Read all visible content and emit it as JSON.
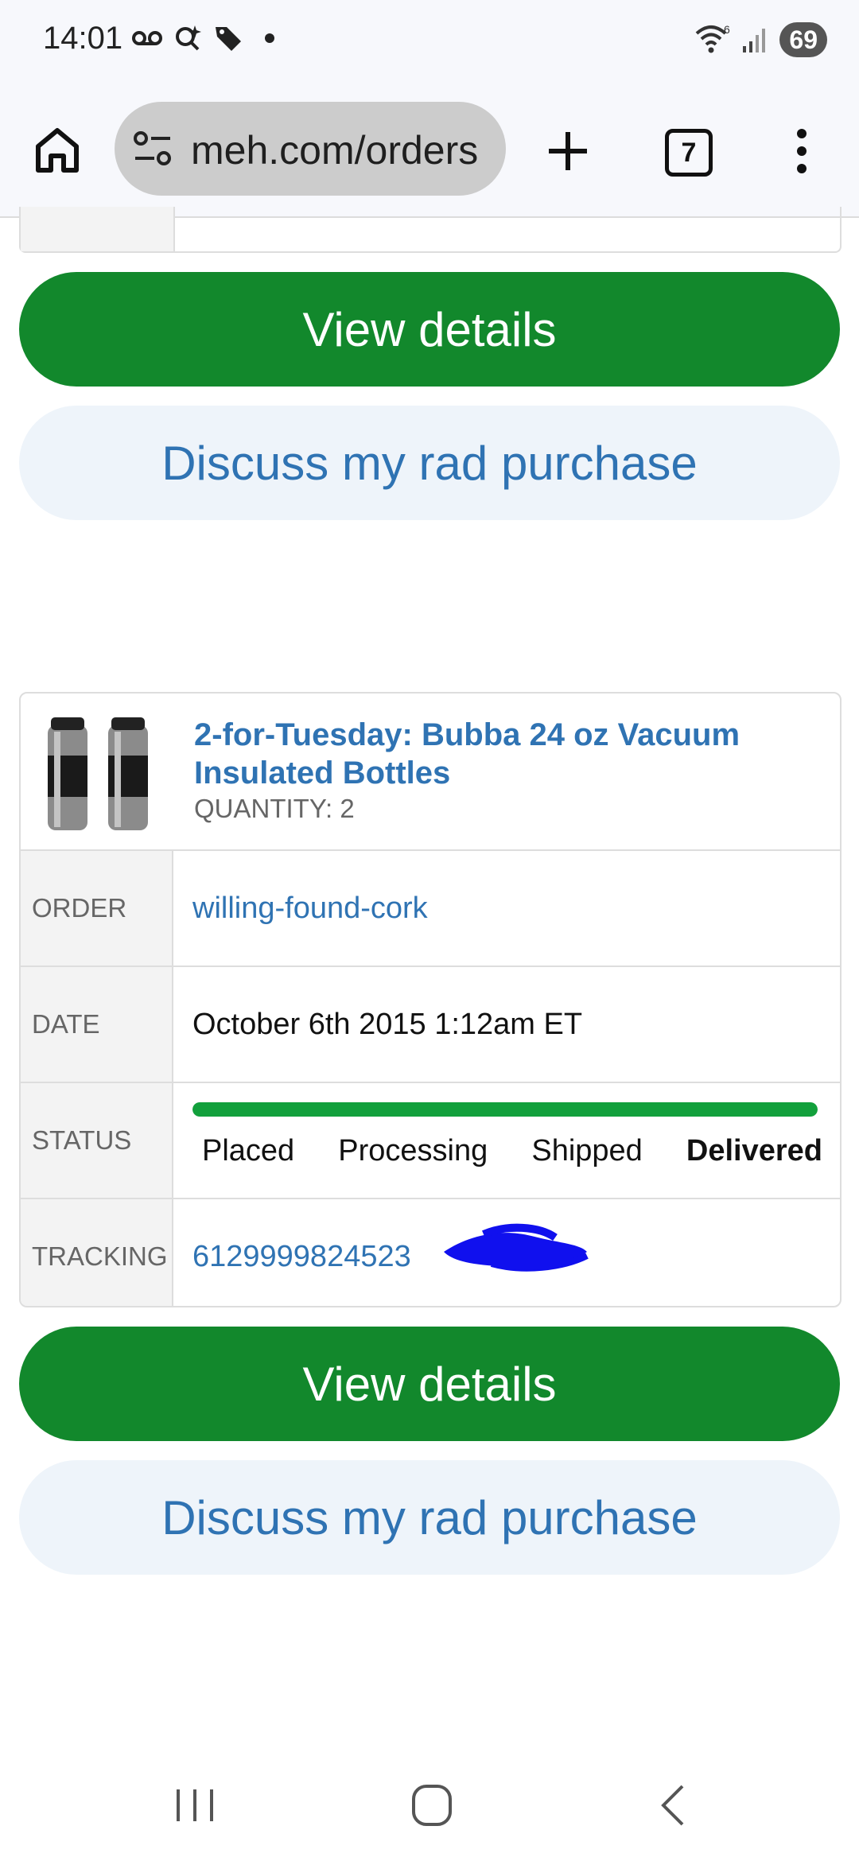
{
  "status_bar": {
    "time": "14:01",
    "battery": "69",
    "icons": [
      "voicemail-icon",
      "search-sparkle-icon",
      "tag-icon",
      "dot-icon",
      "wifi-icon",
      "signal-icon",
      "battery-icon"
    ]
  },
  "browser": {
    "url": "meh.com/orders",
    "tab_count": "7",
    "icons": [
      "home-icon",
      "site-settings-icon",
      "plus-icon",
      "tabs-icon",
      "more-vert-icon"
    ]
  },
  "previous_order_actions": {
    "view_details": "View details",
    "discuss": "Discuss my rad purchase"
  },
  "order": {
    "product_title": "2-for-Tuesday: Bubba 24 oz Vacuum Insulated Bottles",
    "quantity": "QUANTITY: 2",
    "labels": {
      "order": "ORDER",
      "date": "DATE",
      "status": "STATUS",
      "tracking": "TRACKING"
    },
    "order_id": "willing-found-cork",
    "date": "October 6th 2015 1:12am ET",
    "status_steps": [
      "Placed",
      "Processing",
      "Shipped",
      "Delivered"
    ],
    "status_current": "Delivered",
    "status_progress": 1.0,
    "tracking": "6129999824523",
    "colors": {
      "progress": "#12a03c",
      "link": "#2f73b3",
      "redaction": "#1010ee"
    }
  },
  "order_actions": {
    "view_details": "View details",
    "discuss": "Discuss my rad purchase"
  },
  "colors": {
    "primary_button": "#12882c",
    "secondary_button_bg": "#eef4fa",
    "secondary_button_text": "#2f73b3"
  },
  "nav": {
    "icons": [
      "recents-icon",
      "home-circle-icon",
      "back-icon"
    ]
  }
}
